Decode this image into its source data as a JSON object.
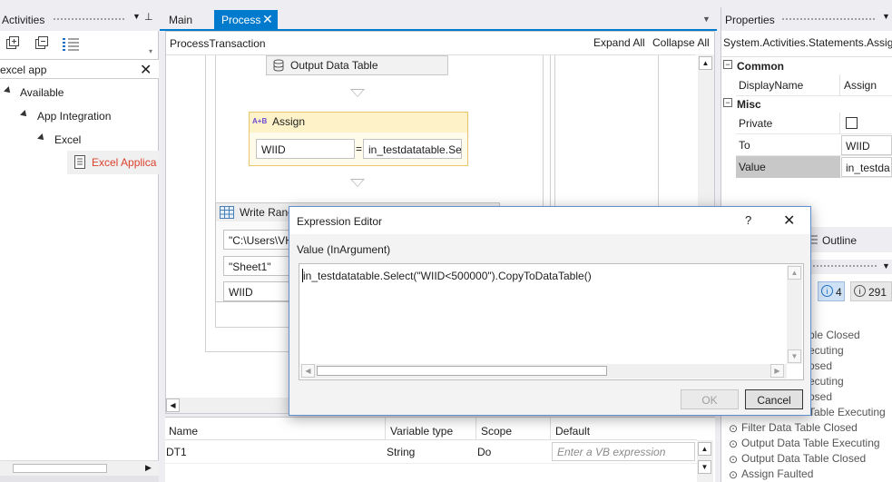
{
  "activities_panel": {
    "title": "Activities",
    "search_value": "excel app",
    "tree": {
      "available": "Available",
      "app_integration": "App Integration",
      "excel": "Excel",
      "excel_app": "Excel Applica"
    }
  },
  "tabs": [
    {
      "label": "Main"
    },
    {
      "label": "Process"
    }
  ],
  "designer": {
    "breadcrumb": "ProcessTransaction",
    "expand_all": "Expand All",
    "collapse_all": "Collapse All",
    "output_data_table": "Output Data Table",
    "assign": {
      "title": "Assign",
      "icon_text": "A+B",
      "to": "WIID",
      "equals": "=",
      "value": "in_testdatatable.Se"
    },
    "write_range": {
      "title": "Write Rang",
      "path": "\"C:\\Users\\VH",
      "sheet": "\"Sheet1\"",
      "var": "WIID"
    }
  },
  "variables": {
    "headers": [
      "Name",
      "Variable type",
      "Scope",
      "Default"
    ],
    "rows": [
      {
        "name": "DT1",
        "type": "String",
        "scope": "Do",
        "default_placeholder": "Enter a VB expression"
      }
    ]
  },
  "properties": {
    "title": "Properties",
    "type": "System.Activities.Statements.Assign",
    "common_label": "Common",
    "misc_label": "Misc",
    "rows": [
      {
        "label": "DisplayName",
        "value": "Assign"
      },
      {
        "label": "Private",
        "value": ""
      },
      {
        "label": "To",
        "value": "WIID"
      },
      {
        "label": "Value",
        "value": "in_testda"
      }
    ]
  },
  "outline": {
    "label": "Outline",
    "info_count": "4",
    "info_count2": "291"
  },
  "log": [
    "ble Closed",
    "ecuting",
    "osed",
    "ecuting",
    "osed",
    "Table Executing",
    "Filter Data Table Closed",
    "Output Data Table Executing",
    "Output Data Table Closed",
    "Assign Faulted"
  ],
  "dialog": {
    "title": "Expression Editor",
    "help": "?",
    "arg_label": "Value (InArgument)",
    "expression": "in_testdatatable.Select(\"WIID<500000\").CopyToDataTable()",
    "ok": "OK",
    "cancel": "Cancel"
  },
  "colors": {
    "accent": "#007acc",
    "assign_header": "#fdf2c8",
    "excel_app": "#d9412d"
  }
}
